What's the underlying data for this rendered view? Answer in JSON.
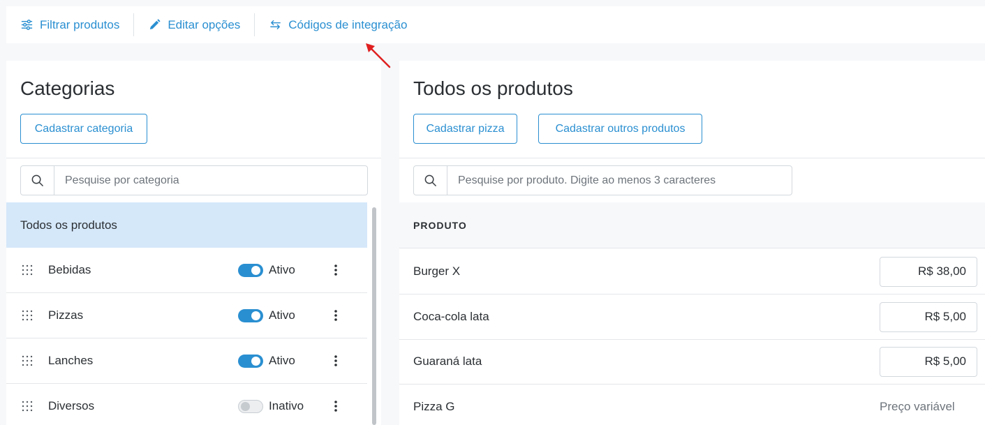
{
  "toolbar": {
    "filter_label": "Filtrar produtos",
    "edit_label": "Editar opções",
    "codes_label": "Códigos de integração"
  },
  "categories_panel": {
    "title": "Categorias",
    "add_button": "Cadastrar categoria",
    "search_placeholder": "Pesquise por categoria",
    "all_label": "Todos os produtos",
    "items": [
      {
        "name": "Bebidas",
        "status": "Ativo",
        "active": true
      },
      {
        "name": "Pizzas",
        "status": "Ativo",
        "active": true
      },
      {
        "name": "Lanches",
        "status": "Ativo",
        "active": true
      },
      {
        "name": "Diversos",
        "status": "Inativo",
        "active": false
      }
    ]
  },
  "products_panel": {
    "title": "Todos os produtos",
    "add_pizza_button": "Cadastrar pizza",
    "add_other_button": "Cadastrar outros produtos",
    "search_placeholder": "Pesquise por produto. Digite ao menos 3 caracteres",
    "column_header": "PRODUTO",
    "rows": [
      {
        "name": "Burger X",
        "price": "R$ 38,00"
      },
      {
        "name": "Coca-cola lata",
        "price": "R$ 5,00"
      },
      {
        "name": "Guaraná lata",
        "price": "R$ 5,00"
      },
      {
        "name": "Pizza G",
        "price": "Preço variável"
      }
    ]
  },
  "colors": {
    "accent": "#2a8fd1",
    "selected_bg": "#d5e8fa",
    "annotation_arrow": "#e02020"
  }
}
